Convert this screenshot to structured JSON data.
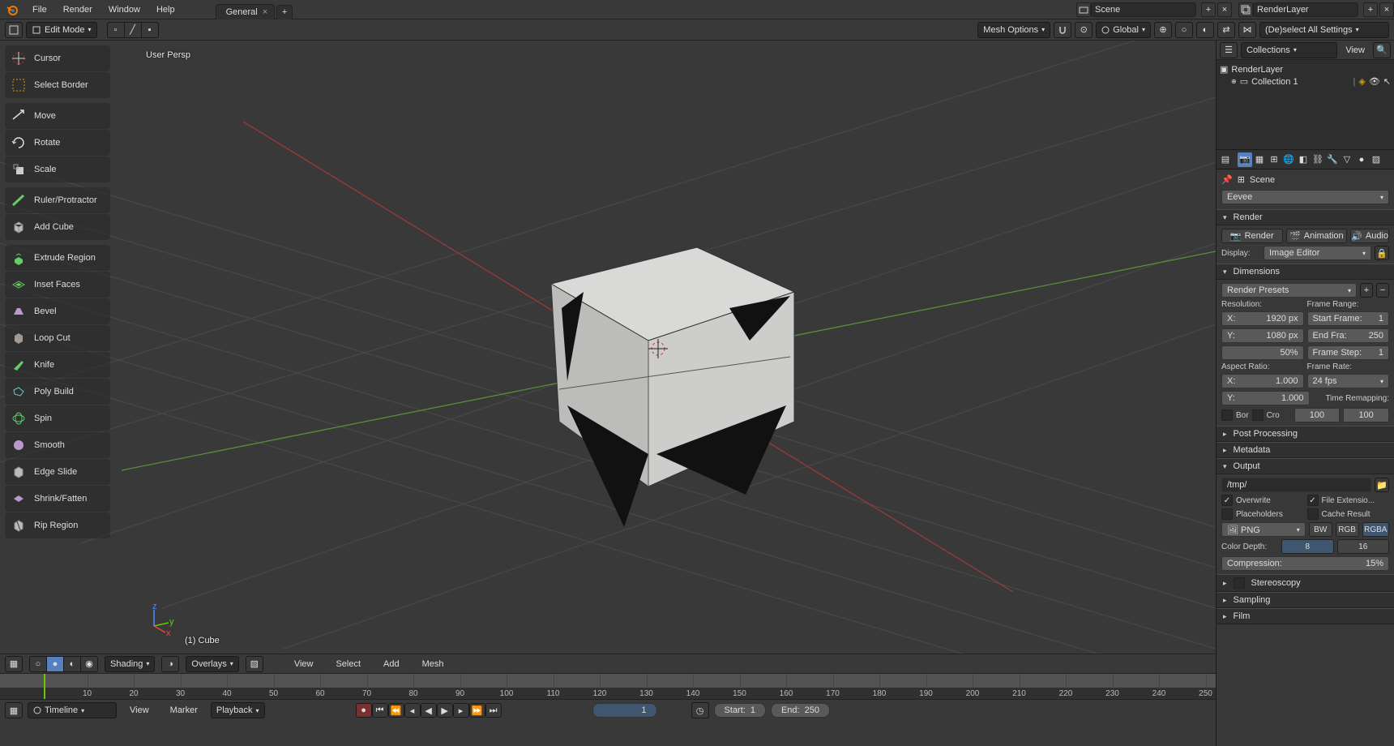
{
  "topmenu": {
    "file": "File",
    "render": "Render",
    "window": "Window",
    "help": "Help"
  },
  "tabs": {
    "general": "General"
  },
  "header_right": {
    "scene": "Scene",
    "renderlayer": "RenderLayer"
  },
  "toolbar": {
    "mode": "Edit Mode",
    "mesh_options": "Mesh Options",
    "global": "Global",
    "deselect_all": "(De)select All Settings"
  },
  "tools": [
    "Cursor",
    "Select Border",
    "Move",
    "Rotate",
    "Scale",
    "Ruler/Protractor",
    "Add Cube",
    "Extrude Region",
    "Inset Faces",
    "Bevel",
    "Loop Cut",
    "Knife",
    "Poly Build",
    "Spin",
    "Smooth",
    "Edge Slide",
    "Shrink/Fatten",
    "Rip Region"
  ],
  "viewport": {
    "persp": "User Persp",
    "obj": "(1) Cube"
  },
  "view_footer": {
    "shading": "Shading",
    "overlays": "Overlays",
    "view": "View",
    "select": "Select",
    "add": "Add",
    "mesh": "Mesh"
  },
  "outliner": {
    "label": "Collections",
    "view": "View",
    "root": "RenderLayer",
    "coll": "Collection 1"
  },
  "props": {
    "breadcrumb": "Scene",
    "engine": "Eevee",
    "render": {
      "hdr": "Render",
      "btn_render": "Render",
      "btn_anim": "Animation",
      "btn_audio": "Audio",
      "display": "Display:",
      "display_val": "Image Editor"
    },
    "dims": {
      "hdr": "Dimensions",
      "presets": "Render Presets",
      "resolution": "Resolution:",
      "frame_range": "Frame Range:",
      "x": "X:",
      "xval": "1920 px",
      "y": "Y:",
      "yval": "1080 px",
      "pct": "50%",
      "start": "Start Frame:",
      "startv": "1",
      "end": "End Fra:",
      "endv": "250",
      "step": "Frame Step:",
      "stepv": "1",
      "aspect": "Aspect Ratio:",
      "ax": "X:",
      "axv": "1.000",
      "ay": "Y:",
      "ayv": "1.000",
      "frate": "Frame Rate:",
      "fratev": "24 fps",
      "tremap": "Time Remapping:",
      "t1": "100",
      "t2": "100",
      "bor": "Bor",
      "cro": "Cro"
    },
    "post": "Post Processing",
    "meta": "Metadata",
    "output": {
      "hdr": "Output",
      "path": "/tmp/",
      "overwrite": "Overwrite",
      "fileext": "File Extensio...",
      "placeholders": "Placeholders",
      "cache": "Cache Result",
      "fmt": "PNG",
      "bw": "BW",
      "rgb": "RGB",
      "rgba": "RGBA",
      "cdepth": "Color Depth:",
      "d8": "8",
      "d16": "16",
      "comp": "Compression:",
      "compv": "15%"
    },
    "stereo": "Stereoscopy",
    "sampling": "Sampling",
    "film": "Film"
  },
  "timeline": {
    "label": "Timeline",
    "view": "View",
    "marker": "Marker",
    "playback": "Playback",
    "frame": "1",
    "start_l": "Start:",
    "start_v": "1",
    "end_l": "End:",
    "end_v": "250",
    "ticks": [
      10,
      20,
      30,
      40,
      50,
      60,
      70,
      80,
      90,
      100,
      110,
      120,
      130,
      140,
      150,
      160,
      170,
      180,
      190,
      200,
      210,
      220,
      230,
      240,
      250
    ]
  }
}
